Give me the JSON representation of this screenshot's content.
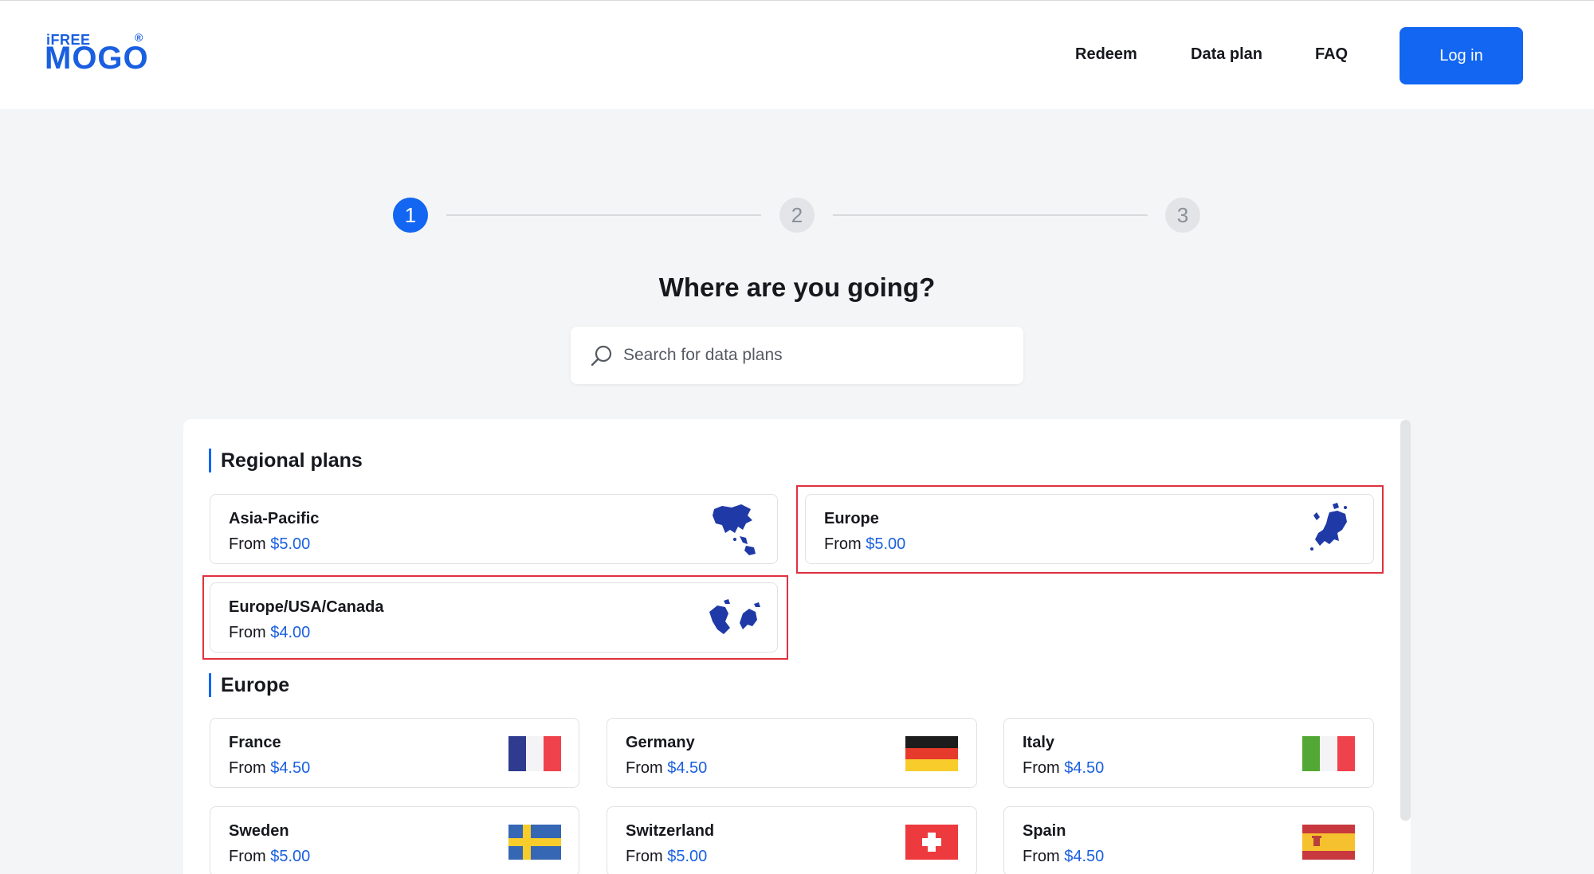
{
  "header": {
    "logo_top": "iFREE",
    "logo_main": "MOGO",
    "logo_reg": "®",
    "nav": [
      "Redeem",
      "Data plan",
      "FAQ"
    ],
    "login_label": "Log in",
    "accent_color": "#1266f1"
  },
  "stepper": {
    "steps": [
      "1",
      "2",
      "3"
    ],
    "active_step": 1
  },
  "title": "Where are you going?",
  "search": {
    "placeholder": "Search for data plans",
    "icon": "search-icon"
  },
  "regional": {
    "heading": "Regional plans",
    "cards": [
      {
        "name": "Asia-Pacific",
        "prefix": "From",
        "price": "$5.00",
        "icon": "asia-pacific-map-icon"
      },
      {
        "name": "Europe",
        "prefix": "From",
        "price": "$5.00",
        "icon": "europe-map-icon"
      },
      {
        "name": "Europe/USA/Canada",
        "prefix": "From",
        "price": "$4.00",
        "icon": "europe-usa-canada-map-icon"
      }
    ]
  },
  "europe": {
    "heading": "Europe",
    "cards": [
      {
        "name": "France",
        "prefix": "From",
        "price": "$4.50",
        "icon": "france-flag-icon"
      },
      {
        "name": "Germany",
        "prefix": "From",
        "price": "$4.50",
        "icon": "germany-flag-icon"
      },
      {
        "name": "Italy",
        "prefix": "From",
        "price": "$4.50",
        "icon": "italy-flag-icon"
      },
      {
        "name": "Sweden",
        "prefix": "From",
        "price": "$5.00",
        "icon": "sweden-flag-icon"
      },
      {
        "name": "Switzerland",
        "prefix": "From",
        "price": "$5.00",
        "icon": "switzerland-flag-icon"
      },
      {
        "name": "Spain",
        "prefix": "From",
        "price": "$4.50",
        "icon": "spain-flag-icon"
      }
    ]
  },
  "highlight_color": "#e0313f"
}
